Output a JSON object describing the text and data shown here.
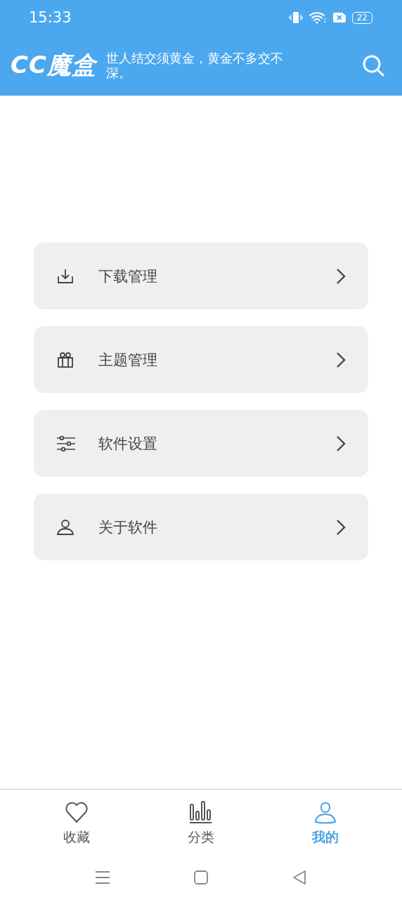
{
  "status_bar": {
    "time": "15:33",
    "battery": "22"
  },
  "header": {
    "logo": "CC魔盒",
    "motto": "世人结交须黄金，黄金不多交不深。"
  },
  "menu": [
    {
      "kind": "download",
      "label": "下载管理"
    },
    {
      "kind": "gift",
      "label": "主题管理"
    },
    {
      "kind": "sliders",
      "label": "软件设置"
    },
    {
      "kind": "person",
      "label": "关于软件"
    }
  ],
  "tabs": [
    {
      "kind": "heart",
      "label": "收藏",
      "selected": false
    },
    {
      "kind": "bars",
      "label": "分类",
      "selected": false
    },
    {
      "kind": "person",
      "label": "我的",
      "selected": true
    }
  ]
}
